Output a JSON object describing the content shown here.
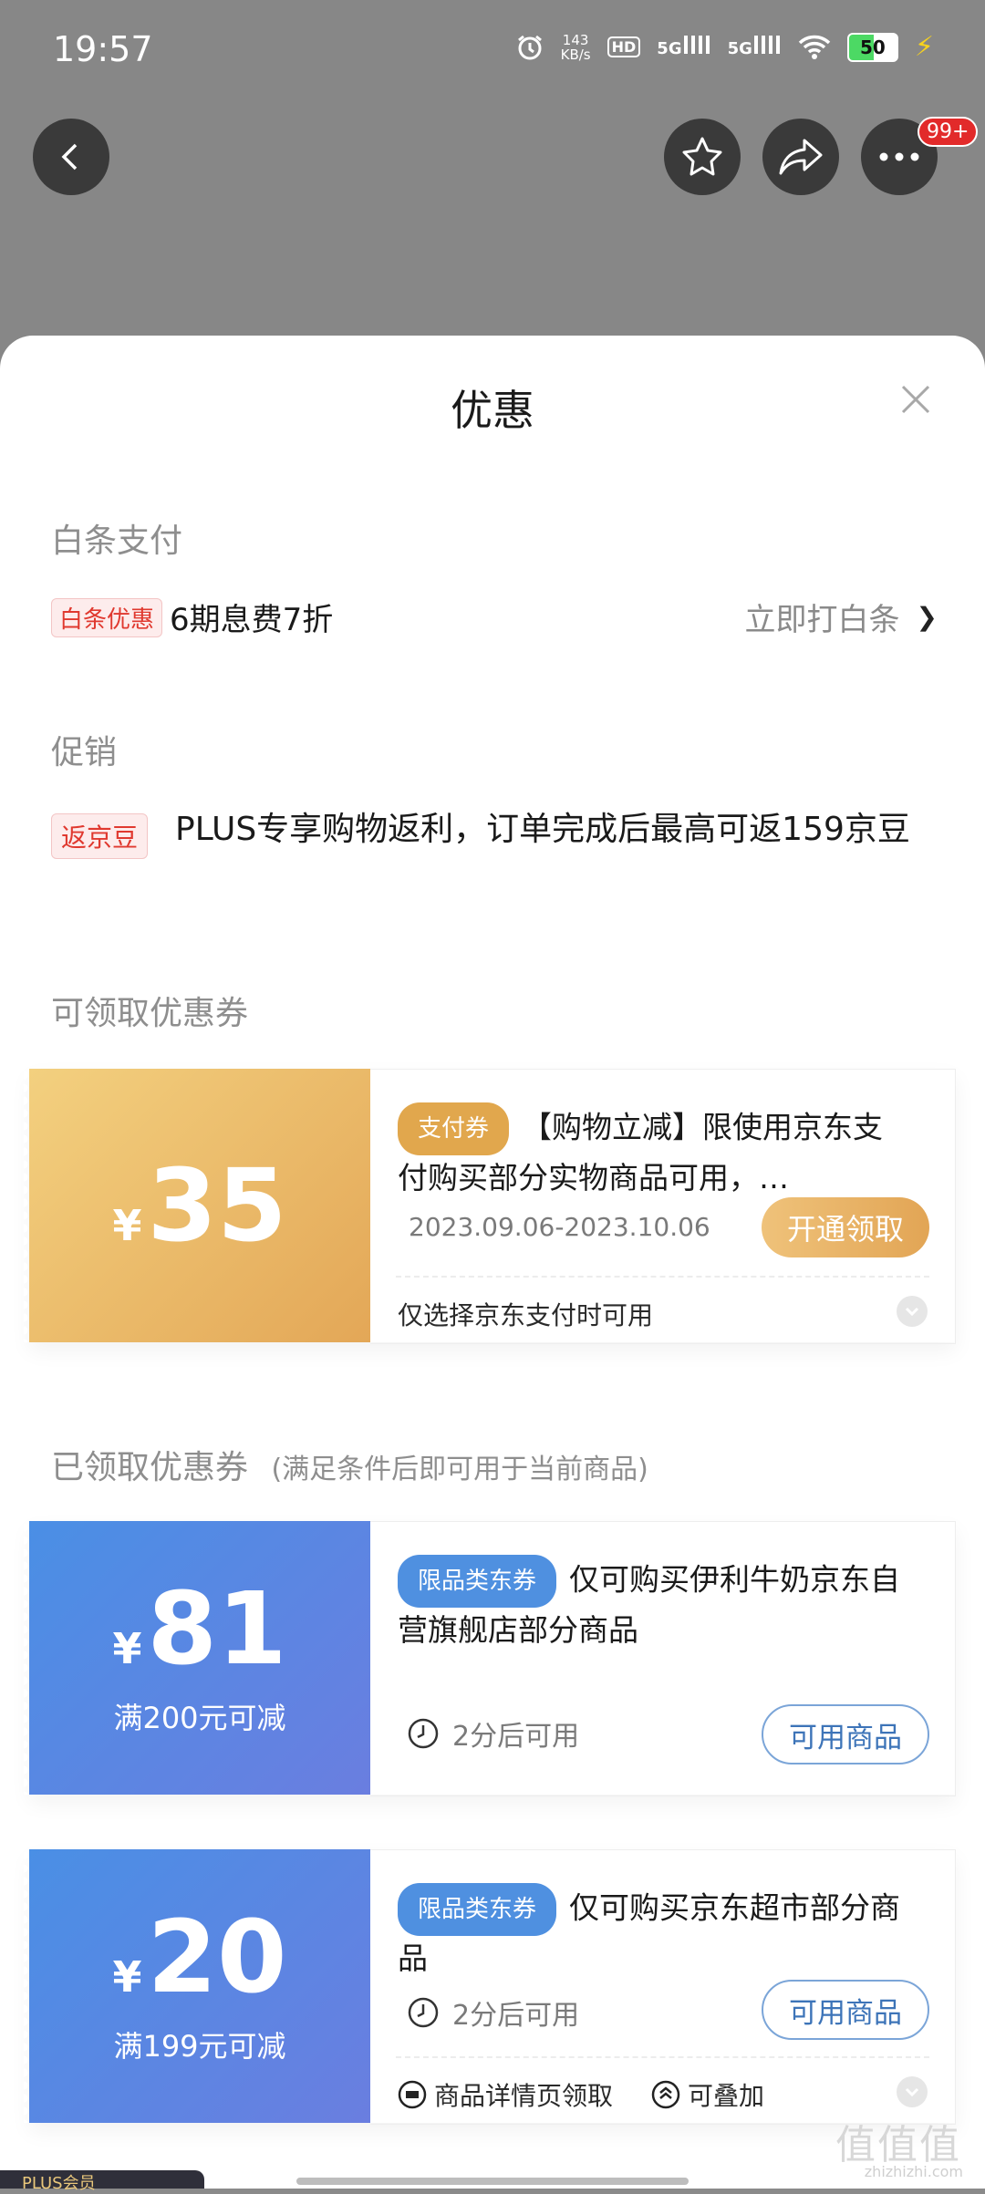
{
  "status_bar": {
    "time": "19:57",
    "net_speed_value": "143",
    "net_speed_unit": "KB/s",
    "hd_label": "HD",
    "signal_1": "5G",
    "signal_2": "5G",
    "battery": "50"
  },
  "top_actions": {
    "badge": "99+"
  },
  "sheet": {
    "title": "优惠"
  },
  "baitiao": {
    "section_title": "白条支付",
    "tag": "白条优惠",
    "text": "6期息费7折",
    "link": "立即打白条",
    "link_chevron": "❯"
  },
  "promotion": {
    "section_title": "促销",
    "tag": "返京豆",
    "text": "PLUS专享购物返利，订单完成后最高可返159京豆"
  },
  "available_coupons": {
    "section_title": "可领取优惠券",
    "items": [
      {
        "yen": "¥",
        "amount": "35",
        "type": "支付券",
        "title": "【购物立减】限使用京东支付购买部分实物商品可用，…",
        "date": "2023.09.06-2023.10.06",
        "button": "开通领取",
        "footer": "仅选择京东支付时可用"
      }
    ]
  },
  "received_coupons": {
    "section_title": "已领取优惠券",
    "section_note": "(满足条件后即可用于当前商品)",
    "items": [
      {
        "yen": "¥",
        "amount": "81",
        "condition": "满200元可减",
        "type": "限品类东券",
        "title": "仅可购买伊利牛奶京东自营旗舰店部分商品",
        "availability": "2分后可用",
        "button": "可用商品"
      },
      {
        "yen": "¥",
        "amount": "20",
        "condition": "满199元可减",
        "type": "限品类东券",
        "title": "仅可购买京东超市部分商品",
        "availability": "2分后可用",
        "button": "可用商品",
        "footer_1": "商品详情页领取",
        "footer_2": "可叠加"
      }
    ]
  },
  "peek": {
    "plus_label": "PLUS会员"
  },
  "watermark": {
    "main": "值值值",
    "sub": "zhizhizhi.com"
  },
  "colors": {
    "gold_start": "#f3d07f",
    "gold_end": "#e3a757",
    "blue_start": "#4a8fe5",
    "blue_end": "#6a7ee0",
    "tag_red": "#e0392f",
    "coupon_type_gold": "#e1a74d",
    "coupon_type_blue": "#4f90e0"
  }
}
